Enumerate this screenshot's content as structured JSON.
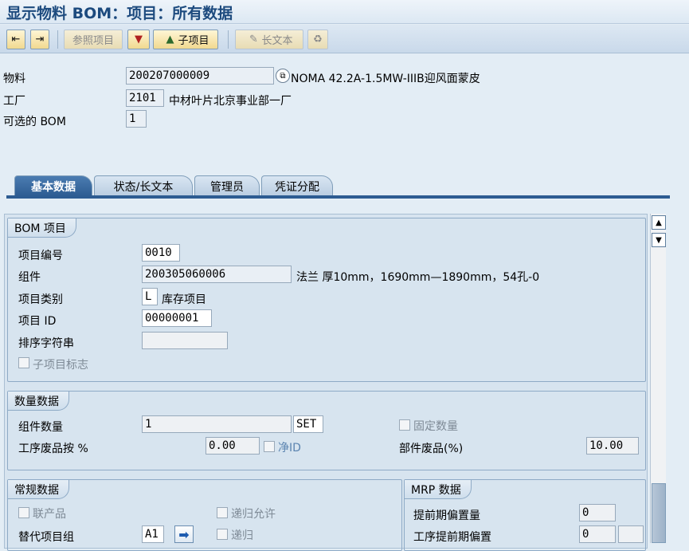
{
  "window": {
    "title": "显示物料 BOM：项目：所有数据"
  },
  "toolbar": {
    "reference_item_label": "参照项目",
    "subitem_label": "子项目",
    "long_text_label": "长文本",
    "icons": [
      "page-prev-icon",
      "page-next-icon",
      "ink-pad-icon",
      "mountain-icon",
      "edit-pencil-icon",
      "recycle-icon"
    ]
  },
  "header": {
    "material_label": "物料",
    "material_value": "200207000009",
    "material_desc": "NOMA 42.2A-1.5MW-IIIB迎风面蒙皮",
    "plant_label": "工厂",
    "plant_value": "2101",
    "plant_desc": "中材叶片北京事业部一厂",
    "alt_bom_label": "可选的 BOM",
    "alt_bom_value": "1"
  },
  "tabs": [
    {
      "label": "基本数据",
      "active": true
    },
    {
      "label": "状态/长文本",
      "active": false
    },
    {
      "label": "管理员",
      "active": false
    },
    {
      "label": "凭证分配",
      "active": false
    }
  ],
  "bom_item": {
    "title": "BOM 项目",
    "item_no_label": "项目编号",
    "item_no": "0010",
    "component_label": "组件",
    "component": "200305060006",
    "component_desc": "法兰 厚10mm，1690mm—1890mm，54孔-0",
    "item_cat_label": "项目类别",
    "item_cat": "L",
    "item_cat_desc": "库存项目",
    "item_id_label": "项目 ID",
    "item_id": "00000001",
    "sort_string_label": "排序字符串",
    "sort_string": "",
    "subitem_flag_label": "子项目标志"
  },
  "quantity": {
    "title": "数量数据",
    "comp_qty_label": "组件数量",
    "comp_qty": "1",
    "unit": "SET",
    "fixed_qty_label": "固定数量",
    "op_scrap_label": "工序废品按 %",
    "op_scrap": "0.00",
    "net_id_label": "净ID",
    "comp_scrap_label": "部件废品(%)",
    "comp_scrap": "10.00"
  },
  "general": {
    "title": "常规数据",
    "co_product_label": "联产品",
    "recursive_allowed_label": "递归允许",
    "alt_group_label": "替代项目组",
    "alt_group": "A1",
    "recursive_label": "递归"
  },
  "mrp": {
    "title": "MRP 数据",
    "lead_offset_label": "提前期偏置量",
    "lead_offset": "0",
    "op_lead_offset_label": "工序提前期偏置",
    "op_lead_offset": "0"
  }
}
